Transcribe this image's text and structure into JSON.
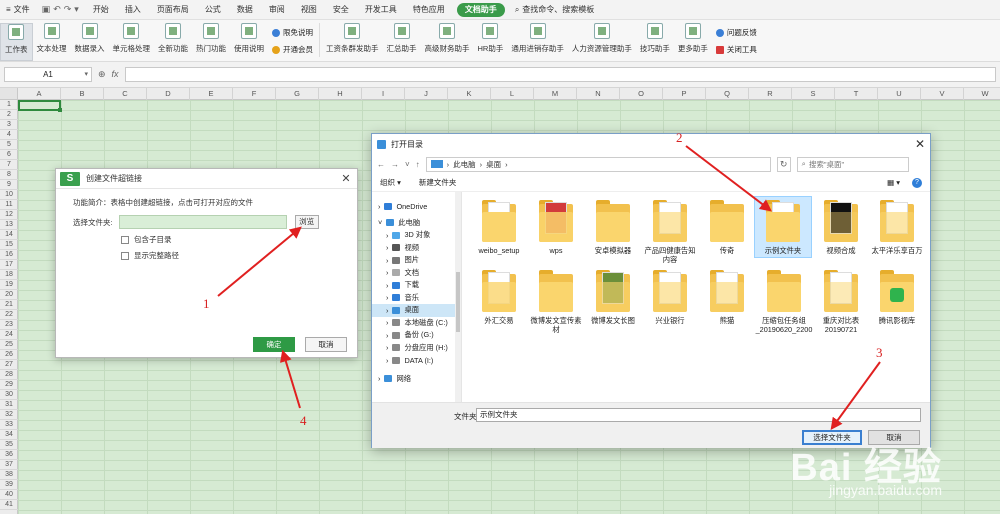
{
  "menubar": {
    "file_label": "文件",
    "tabs": [
      "开始",
      "插入",
      "页面布局",
      "公式",
      "数据",
      "审阅",
      "视图",
      "安全",
      "开发工具",
      "特色应用"
    ],
    "active_tab": "文档助手",
    "search_label": "查找命令、搜索模板"
  },
  "ribbon": {
    "big_buttons": [
      "工作表",
      "文本处理",
      "数据录入",
      "单元格处理",
      "全新功能",
      "热门功能",
      "使用说明"
    ],
    "small_a": [
      "限免说明",
      "开通会员"
    ],
    "helpers": [
      "工资条群发助手",
      "汇总助手",
      "高级财务助手",
      "HR助手",
      "通用进销存助手",
      "人力资源管理助手",
      "技巧助手",
      "更多助手"
    ],
    "small_b": [
      "问题反馈",
      "关闭工具"
    ]
  },
  "formula_bar": {
    "cell_ref": "A1",
    "fx": "fx",
    "value": ""
  },
  "sheet": {
    "columns": [
      "A",
      "B",
      "C",
      "D",
      "E",
      "F",
      "G",
      "H",
      "I",
      "J",
      "K",
      "L",
      "M",
      "N",
      "O",
      "P",
      "Q",
      "R",
      "S",
      "T",
      "U",
      "V",
      "W"
    ],
    "rows": [
      "1",
      "2",
      "3",
      "4",
      "5",
      "6",
      "7",
      "8",
      "9",
      "10",
      "11",
      "12",
      "13",
      "14",
      "15",
      "16",
      "17",
      "18",
      "19",
      "20",
      "21",
      "22",
      "23",
      "24",
      "25",
      "26",
      "27",
      "28",
      "29",
      "30",
      "31",
      "32",
      "33",
      "34",
      "35",
      "36",
      "37",
      "38",
      "39",
      "40",
      "41"
    ]
  },
  "hyperlink_dialog": {
    "logo": "S",
    "title": "创建文件超链接",
    "intro": "功能简介：表格中创建超链接，点击可打开对应的文件",
    "folder_label": "选择文件夹:",
    "folder_value": "",
    "browse": "浏览",
    "opt_subdirs": "包含子目录",
    "opt_fullpath": "显示完整路径",
    "ok": "确定",
    "cancel": "取消"
  },
  "open_dialog": {
    "title": "打开目录",
    "breadcrumb": [
      "此电脑",
      "桌面"
    ],
    "search_placeholder": "搜索\"桌面\"",
    "organize": "组织 ▾",
    "new_folder": "新建文件夹",
    "sidebar": [
      "OneDrive",
      "此电脑",
      "3D 对象",
      "视频",
      "图片",
      "文档",
      "下载",
      "音乐",
      "桌面",
      "本地磁盘 (C:)",
      "备份 (G:)",
      "分盘应用 (H:)",
      "DATA (I:)",
      "网络"
    ],
    "selected_sidebar": "桌面",
    "files": [
      "weibo_setup",
      "wps",
      "安卓模拟器",
      "产品四健康告知内容",
      "传奇",
      "示例文件夹",
      "视频合成",
      "太平洋乐享百万",
      "外汇交易",
      "微博发文宣传素材",
      "微博发文长图",
      "兴业银行",
      "熊猫",
      "压缩包任务组_20190620_2200",
      "重庆对比表20190721",
      "腾讯影视库"
    ],
    "selected_file": "示例文件夹",
    "folder_label": "文件夹:",
    "folder_value": "示例文件夹",
    "select_btn": "选择文件夹",
    "cancel_btn": "取消"
  },
  "annotations": [
    "1",
    "2",
    "3",
    "4"
  ],
  "watermark": {
    "brand": "Bai  经验",
    "url": "jingyan.baidu.com"
  }
}
